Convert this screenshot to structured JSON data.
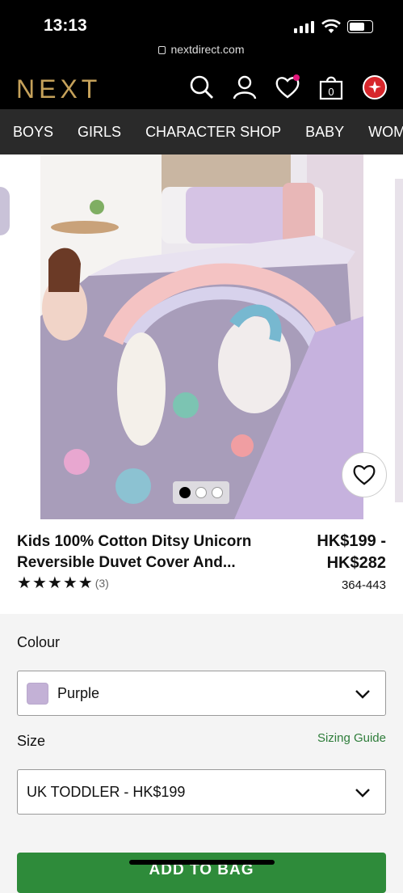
{
  "status_bar": {
    "time": "13:13",
    "url": "nextdirect.com"
  },
  "brand": {
    "logo": "NEXT",
    "logo_color": "#c5a15a"
  },
  "header_icons": [
    "search-icon",
    "account-icon",
    "wishlist-icon",
    "bag-icon",
    "region-flag-icon"
  ],
  "bag": {
    "count": "0"
  },
  "nav": {
    "items": [
      "BOYS",
      "GIRLS",
      "CHARACTER SHOP",
      "BABY",
      "WOMEN"
    ]
  },
  "gallery": {
    "image_count": 3,
    "active_index": 0
  },
  "product": {
    "title": "Kids 100% Cotton Ditsy Unicorn Reversible Duvet Cover And...",
    "price": "HK$199 - HK$282",
    "sku": "364-443",
    "rating": 5,
    "review_count": "(3)"
  },
  "options": {
    "colour_label": "Colour",
    "colour_value": "Purple",
    "colour_swatch": "#c3b1d6",
    "size_label": "Size",
    "size_value": "UK TODDLER - HK$199",
    "sizing_guide": "Sizing Guide"
  },
  "cta": {
    "add_to_bag": "ADD TO BAG",
    "color": "#2e8b3a"
  }
}
